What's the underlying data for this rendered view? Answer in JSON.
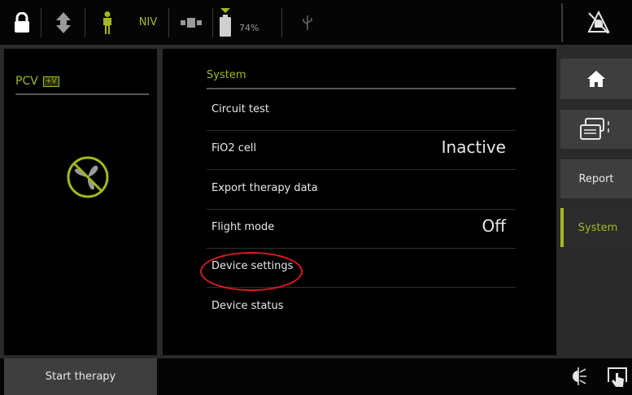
{
  "topbar": {
    "mode_tag": "NIV",
    "battery_percent": "74%",
    "battery_level": 0.74
  },
  "left": {
    "mode": "PCV",
    "mode_badge": "+V"
  },
  "main": {
    "section_title": "System",
    "rows": [
      {
        "label": "Circuit test",
        "value": ""
      },
      {
        "label": "FiO2 cell",
        "value": "Inactive"
      },
      {
        "label": "Export therapy data",
        "value": ""
      },
      {
        "label": "Flight mode",
        "value": "Off"
      },
      {
        "label": "Device settings",
        "value": ""
      },
      {
        "label": "Device status",
        "value": ""
      }
    ]
  },
  "sidebar": {
    "report_label": "Report",
    "system_label": "System"
  },
  "bottom": {
    "start_label": "Start therapy"
  },
  "colors": {
    "accent": "#a5b81f",
    "highlight": "#d81c20",
    "panel": "#000000",
    "button": "#3e3e3e"
  }
}
